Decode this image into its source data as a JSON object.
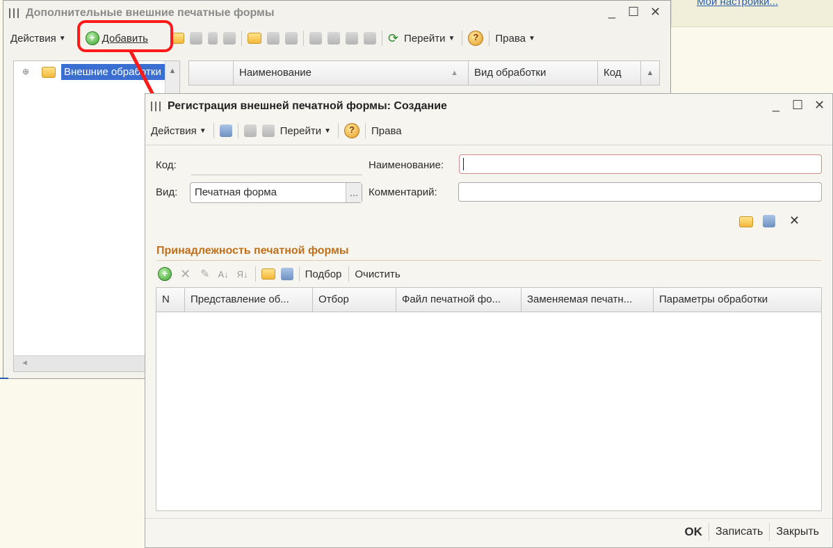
{
  "top_right_link": "Мои настройки...",
  "back_window": {
    "title": "Дополнительные внешние печатные формы",
    "toolbar": {
      "actions": "Действия",
      "add": "Добавить",
      "goto": "Перейти",
      "rights": "Права"
    },
    "tree": {
      "root": "Внешние обработки"
    },
    "columns": [
      "Наименование",
      "Вид обработки",
      "Код"
    ]
  },
  "front_window": {
    "title": "Регистрация внешней печатной формы: Создание",
    "toolbar": {
      "actions": "Действия",
      "goto": "Перейти",
      "rights": "Права"
    },
    "form": {
      "code_label": "Код:",
      "code_value": "",
      "name_label": "Наименование:",
      "name_value": "",
      "kind_label": "Вид:",
      "kind_value": "Печатная форма",
      "kind_button": "...",
      "comment_label": "Комментарий:",
      "comment_value": ""
    },
    "section_title": "Принадлежность печатной формы",
    "section_toolbar": {
      "pick": "Подбор",
      "clear": "Очистить"
    },
    "table_columns": [
      "N",
      "Представление об...",
      "Отбор",
      "Файл печатной фо...",
      "Заменяемая печатн...",
      "Параметры обработки"
    ],
    "buttons": {
      "ok": "OK",
      "save": "Записать",
      "close": "Закрыть"
    }
  },
  "colors": {
    "highlight": "#ff1a1a",
    "section_title": "#c0701a",
    "selection": "#3a6fd1",
    "background": "#fbf9ec"
  }
}
